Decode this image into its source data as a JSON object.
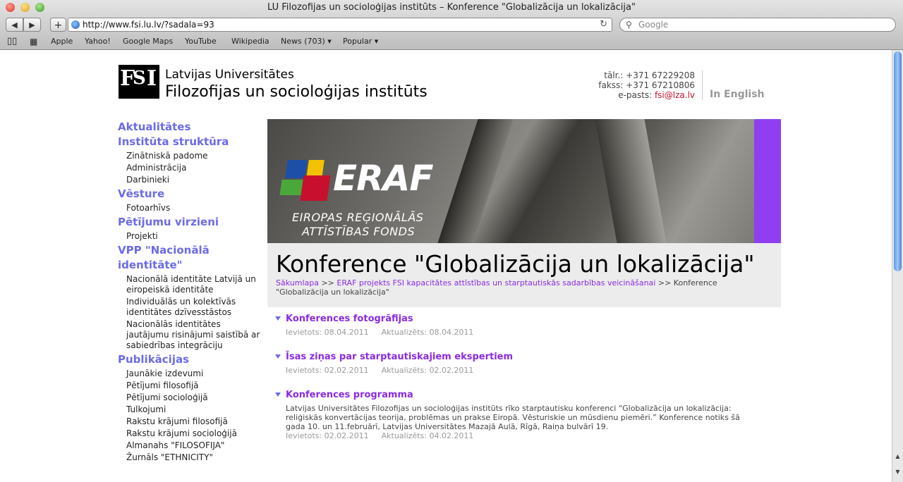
{
  "window": {
    "title": "LU Filozofijas un socioloģijas institūts – Konference  \"Globalizācija un lokalizācija\""
  },
  "toolbar": {
    "back": "◀",
    "forward": "▶",
    "add": "+",
    "url": "http://www.fsi.lu.lv/?sadala=93",
    "search_placeholder": "Google"
  },
  "bookmarks": [
    "Apple",
    "Yahoo!",
    "Google Maps",
    "YouTube",
    "Wikipedia",
    "News (703) ▾",
    "Popular ▾"
  ],
  "header": {
    "logo_text": "FSI",
    "line1": "Latvijas Universitātes",
    "line2": "Filozofijas un socioloģijas institūts",
    "phone": "tālr.: +371 67229208",
    "fax": "fakss: +371 67210806",
    "email_label": "e-pasts: ",
    "email": "fsi@lza.lv",
    "lang_link": "In English"
  },
  "sidebar": {
    "items": [
      {
        "type": "h",
        "label": "Aktualitātes"
      },
      {
        "type": "h",
        "label": "Institūta struktūra"
      },
      {
        "type": "s",
        "label": "Zinātniskā padome"
      },
      {
        "type": "s",
        "label": "Administrācija"
      },
      {
        "type": "s",
        "label": "Darbinieki"
      },
      {
        "type": "h",
        "label": "Vēsture"
      },
      {
        "type": "s",
        "label": "Fotoarhīvs"
      },
      {
        "type": "h",
        "label": "Pētījumu virzieni"
      },
      {
        "type": "s",
        "label": "Projekti"
      },
      {
        "type": "h",
        "label": "VPP \"Nacionālā identitāte\""
      },
      {
        "type": "s",
        "label": "Nacionālā identitāte Latvijā un eiropeiskā identitāte"
      },
      {
        "type": "s",
        "label": "Individuālās un kolektīvās identitātes dzīvesstāstos"
      },
      {
        "type": "s",
        "label": "Nacionālās identitātes jautājumu risinājumi saistībā ar sabiedrības integrāciju"
      },
      {
        "type": "h",
        "label": "Publikācijas"
      },
      {
        "type": "s",
        "label": "Jaunākie izdevumi"
      },
      {
        "type": "s",
        "label": "Pētījumi filosofijā"
      },
      {
        "type": "s",
        "label": "Pētījumi socioloģijā"
      },
      {
        "type": "s",
        "label": "Tulkojumi"
      },
      {
        "type": "s",
        "label": "Rakstu krājumi filosofijā"
      },
      {
        "type": "s",
        "label": "Rakstu krājumi socioloģijā"
      },
      {
        "type": "s",
        "label": "Almanahs \"FILOSOFIJA\""
      },
      {
        "type": "s",
        "label": "Žurnāls \"ETHNICITY\""
      }
    ]
  },
  "banner": {
    "logo": "ERAF",
    "sub1": "EIROPAS REĢIONĀLĀS",
    "sub2": "ATTĪSTĪBAS FONDS"
  },
  "main": {
    "title": "Konference \"Globalizācija un lokalizācija\"",
    "breadcrumb": {
      "home": "Sākumlapa",
      "sep": " >> ",
      "parent": "ERAF projekts FSI kapacitātes attīstības un starptautiskās sadarbības veicināšanai",
      "current": "Konference \"Globalizācija un lokalizācija\""
    },
    "news": [
      {
        "title": "Konferences fotogrāfijas",
        "created": "Ievietots: 08.04.2011",
        "updated": "Aktualizēts: 08.04.2011",
        "text": ""
      },
      {
        "title": "Īsas ziņas par starptautiskajiem ekspertiem",
        "created": "Ievietots: 02.02.2011",
        "updated": "Aktualizēts: 02.02.2011",
        "text": ""
      },
      {
        "title": "Konferences programma",
        "created": "Ievietots: 02.02.2011",
        "updated": "Aktualizēts: 04.02.2011",
        "text": "Latvijas Universitātes Filozofijas un socioloģijas institūts rīko starptautisku konferenci “Globalizācija un lokalizācija: reliģiskās konvertācijas teorija, problēmas un prakse Eiropā. Vēsturiskie un mūsdienu piemēri.” Konference notiks šā gada 10. un 11.februārī, Latvijas Universitātes Mazajā Aulā, Rīgā, Raiņa bulvārī 19."
      }
    ]
  },
  "colors": {
    "accent": "#6b6be8",
    "link": "#8a2be2",
    "stripe": "#8f3ff0",
    "email": "#c8102e"
  }
}
